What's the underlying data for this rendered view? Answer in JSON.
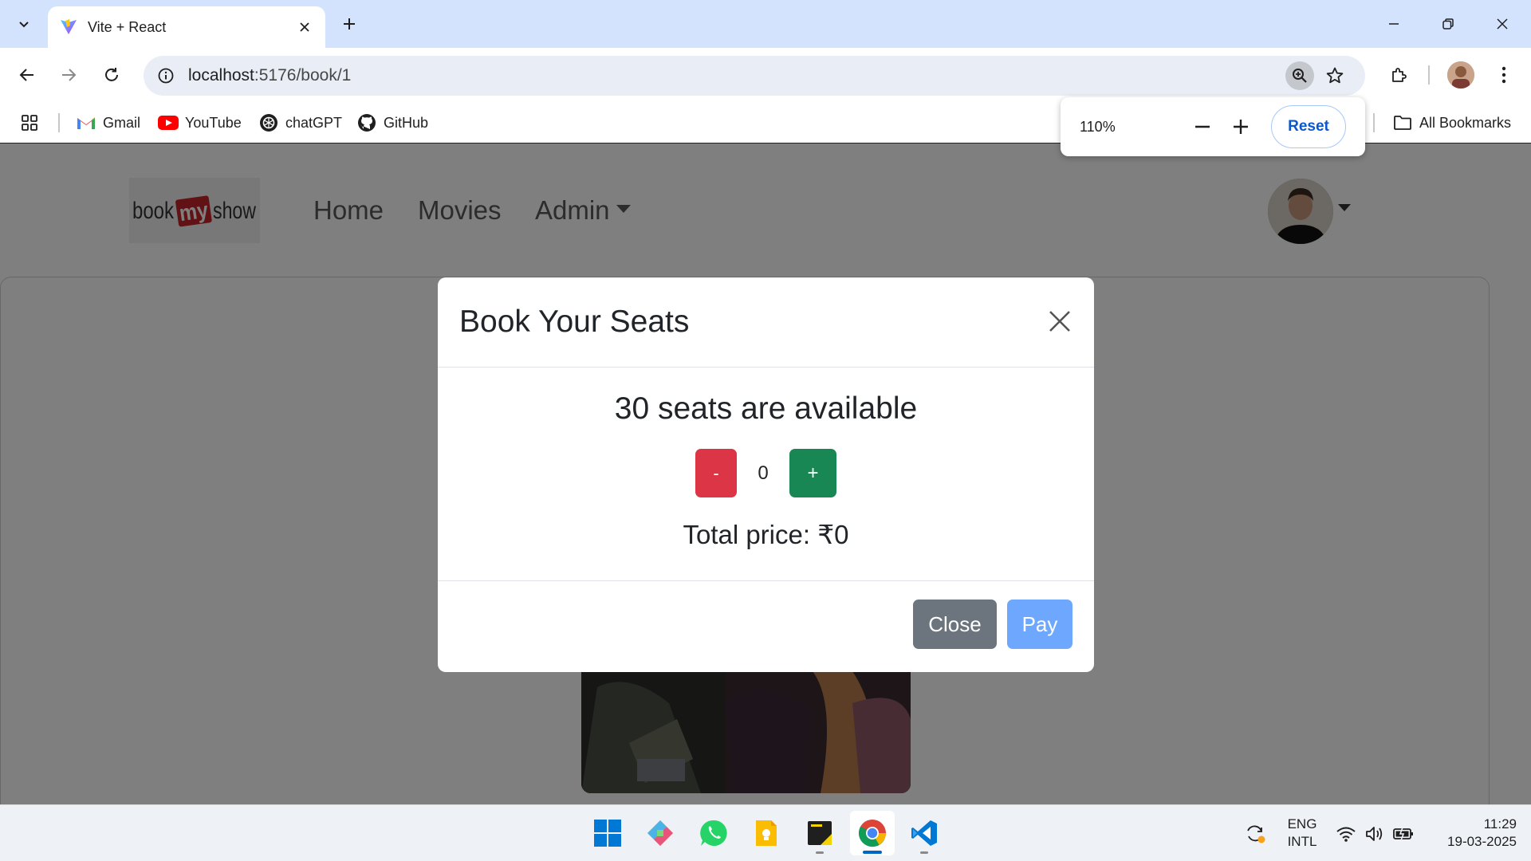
{
  "browser": {
    "tab_title": "Vite + React",
    "url_host": "localhost",
    "url_path": ":5176/book/1",
    "bookmarks": [
      {
        "label": "Gmail",
        "icon": "gmail-icon"
      },
      {
        "label": "YouTube",
        "icon": "youtube-icon"
      },
      {
        "label": "chatGPT",
        "icon": "chatgpt-icon"
      },
      {
        "label": "GitHub",
        "icon": "github-icon"
      }
    ],
    "all_bookmarks": "All Bookmarks",
    "zoom": {
      "level": "110%",
      "reset_label": "Reset"
    }
  },
  "site": {
    "nav": {
      "home": "Home",
      "movies": "Movies",
      "admin": "Admin"
    }
  },
  "modal": {
    "title": "Book Your Seats",
    "availability": "30 seats are available",
    "minus_label": "-",
    "count": "0",
    "plus_label": "+",
    "total_price": "Total price: ₹0",
    "close_label": "Close",
    "pay_label": "Pay"
  },
  "taskbar": {
    "lang_top": "ENG",
    "lang_bottom": "INTL",
    "time": "11:29",
    "date": "19-03-2025"
  },
  "colors": {
    "danger": "#dc3545",
    "success": "#198754",
    "secondary": "#6c757d",
    "primary_disabled": "#6ea8fe",
    "chrome_accent": "#0b57d0"
  }
}
